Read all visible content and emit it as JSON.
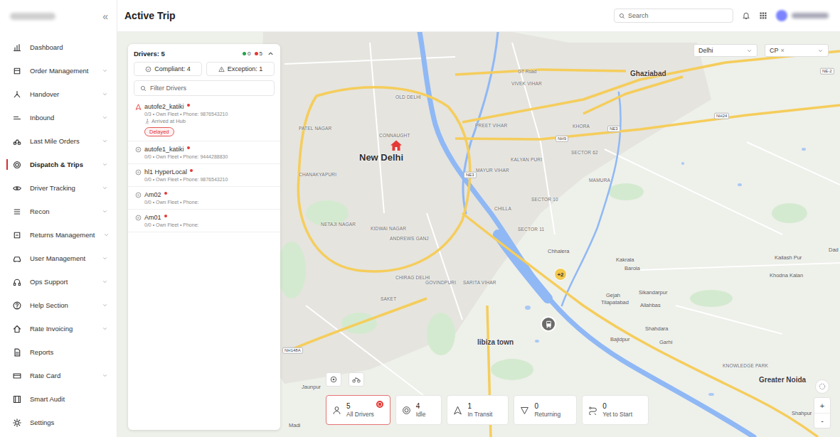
{
  "sidebar": {
    "collapse_glyph": "«",
    "items": [
      {
        "label": "Dashboard",
        "expandable": false,
        "selected": false
      },
      {
        "label": "Order Management",
        "expandable": true,
        "selected": false
      },
      {
        "label": "Handover",
        "expandable": true,
        "selected": false
      },
      {
        "label": "Inbound",
        "expandable": true,
        "selected": false
      },
      {
        "label": "Last Mile Orders",
        "expandable": true,
        "selected": false
      },
      {
        "label": "Dispatch & Trips",
        "expandable": true,
        "selected": true
      },
      {
        "label": "Driver Tracking",
        "expandable": true,
        "selected": false
      },
      {
        "label": "Recon",
        "expandable": true,
        "selected": false
      },
      {
        "label": "Returns Management",
        "expandable": true,
        "selected": false
      },
      {
        "label": "User Management",
        "expandable": true,
        "selected": false
      },
      {
        "label": "Ops Support",
        "expandable": true,
        "selected": false
      },
      {
        "label": "Help Section",
        "expandable": true,
        "selected": false
      },
      {
        "label": "Rate Invoicing",
        "expandable": true,
        "selected": false
      },
      {
        "label": "Reports",
        "expandable": false,
        "selected": false
      },
      {
        "label": "Rate Card",
        "expandable": true,
        "selected": false
      },
      {
        "label": "Smart Audit",
        "expandable": false,
        "selected": false
      },
      {
        "label": "Settings",
        "expandable": false,
        "selected": false
      }
    ]
  },
  "header": {
    "title": "Active Trip",
    "search": {
      "placeholder": "Search"
    }
  },
  "drivers_panel": {
    "title": "Drivers: 5",
    "expanded": true,
    "status_counts": [
      {
        "count": "0",
        "color": "#22a447"
      },
      {
        "count": "5",
        "color": "#e53935"
      }
    ],
    "filters": [
      {
        "label": "Compliant: 4",
        "kind": "compliant"
      },
      {
        "label": "Exception: 1",
        "kind": "exception"
      }
    ],
    "search": {
      "placeholder": "Filter Drivers"
    },
    "drivers": [
      {
        "name": "autofe2_katiki",
        "online": false,
        "status": "transit",
        "meta": "0/3 • Own Fleet • Phone: 9876543210",
        "event": "Arrived at Hub",
        "badge": "Delayed"
      },
      {
        "name": "autofe1_katiki",
        "online": false,
        "status": "idle",
        "meta": "0/0 • Own Fleet • Phone: 9444288830",
        "event": "",
        "badge": ""
      },
      {
        "name": "hl1 HyperLocal",
        "online": false,
        "status": "idle",
        "meta": "0/0 • Own Fleet • Phone: 9876543210",
        "event": "",
        "badge": ""
      },
      {
        "name": "Am02",
        "online": false,
        "status": "idle",
        "meta": "0/0 • Own Fleet • Phone:",
        "event": "",
        "badge": ""
      },
      {
        "name": "Am01",
        "online": false,
        "status": "idle",
        "meta": "0/0 • Own Fleet • Phone:",
        "event": "",
        "badge": ""
      }
    ]
  },
  "map": {
    "region_filter": "Delhi",
    "zone_filter": {
      "value": "CP",
      "clear_glyph": "×"
    },
    "zoom": [
      "+",
      "-"
    ],
    "markers": [
      {
        "kind": "home",
        "label": ""
      },
      {
        "kind": "cluster",
        "label": "+2"
      },
      {
        "kind": "vehicle",
        "label": ""
      }
    ],
    "labels": [
      {
        "text": "New Delhi",
        "kind": "capital"
      },
      {
        "text": "Ghaziabad",
        "kind": "city"
      },
      {
        "text": "Greater Noida",
        "kind": "city"
      },
      {
        "text": "libiza town",
        "kind": "city"
      },
      {
        "text": "Kakrala",
        "kind": "town"
      },
      {
        "text": "Baroia",
        "kind": "town"
      },
      {
        "text": "Kailash Pur",
        "kind": "town"
      },
      {
        "text": "Khodna Kalan",
        "kind": "town"
      },
      {
        "text": "Sikandarpur",
        "kind": "town"
      },
      {
        "text": "Allahbas",
        "kind": "town"
      },
      {
        "text": "Shahdara",
        "kind": "town"
      },
      {
        "text": "Bajidpur",
        "kind": "town"
      },
      {
        "text": "Garhi",
        "kind": "town"
      },
      {
        "text": "Chhalera",
        "kind": "town"
      },
      {
        "text": "Gejah",
        "kind": "town"
      },
      {
        "text": "Tilapatabad",
        "kind": "town"
      },
      {
        "text": "Jaunpur",
        "kind": "town"
      },
      {
        "text": "Madi",
        "kind": "town"
      },
      {
        "text": "Dad",
        "kind": "town"
      },
      {
        "text": "Shahpur",
        "kind": "town"
      },
      {
        "text": "OLD DELHI",
        "kind": "area"
      },
      {
        "text": "CONNAUGHT",
        "kind": "area"
      },
      {
        "text": "CHANAKYAPURI",
        "kind": "area"
      },
      {
        "text": "PATEL NAGAR",
        "kind": "area"
      },
      {
        "text": "NETAJI NAGAR",
        "kind": "area"
      },
      {
        "text": "KIDWAI NAGAR",
        "kind": "area"
      },
      {
        "text": "ANDREWS GANJ",
        "kind": "area"
      },
      {
        "text": "VIVEK VIHAR",
        "kind": "area"
      },
      {
        "text": "PREET VIHAR",
        "kind": "area"
      },
      {
        "text": "MAYUR VIHAR",
        "kind": "area"
      },
      {
        "text": "KALYAN PURI",
        "kind": "area"
      },
      {
        "text": "KHORA",
        "kind": "area"
      },
      {
        "text": "SECTOR 62",
        "kind": "area"
      },
      {
        "text": "MAMURA",
        "kind": "area"
      },
      {
        "text": "CHILLA",
        "kind": "area"
      },
      {
        "text": "SECTOR 10",
        "kind": "area"
      },
      {
        "text": "SECTOR 11",
        "kind": "area"
      },
      {
        "text": "CHIRAG DELHI",
        "kind": "area"
      },
      {
        "text": "GOVINDPURI",
        "kind": "area"
      },
      {
        "text": "SARITA VIHAR",
        "kind": "area"
      },
      {
        "text": "SAKET",
        "kind": "area"
      },
      {
        "text": "KNOWLEDGE PARK",
        "kind": "area"
      },
      {
        "text": "GT Road",
        "kind": "road"
      },
      {
        "text": "NH9",
        "kind": "shield"
      },
      {
        "text": "NE3",
        "kind": "shield"
      },
      {
        "text": "NE3",
        "kind": "shield"
      },
      {
        "text": "NH24",
        "kind": "shield"
      },
      {
        "text": "NE-2",
        "kind": "shield"
      },
      {
        "text": "NH148A",
        "kind": "shield"
      }
    ]
  },
  "stats": [
    {
      "count": "5",
      "label": "All Drivers",
      "kind": "all",
      "selected": true
    },
    {
      "count": "4",
      "label": "Idle",
      "kind": "idle",
      "selected": false
    },
    {
      "count": "1",
      "label": "In Transit",
      "kind": "transit",
      "selected": false
    },
    {
      "count": "0",
      "label": "Returning",
      "kind": "returning",
      "selected": false
    },
    {
      "count": "0",
      "label": "Yet to Start",
      "kind": "pending",
      "selected": false
    }
  ]
}
